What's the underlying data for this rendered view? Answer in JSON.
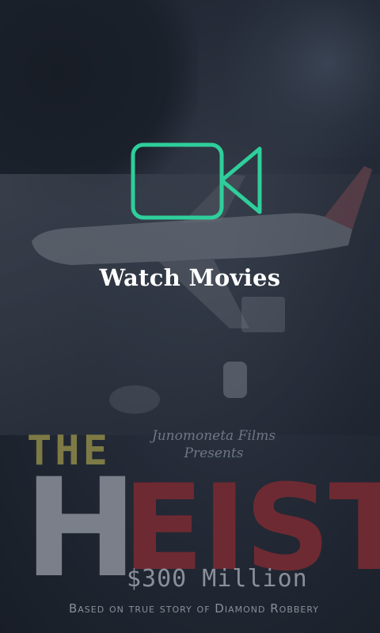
{
  "splash": {
    "icon": "video-camera-icon",
    "icon_color": "#2ecf9a",
    "title": "Watch Movies"
  },
  "poster": {
    "credit_line1": "Junomoneta Films",
    "credit_line2": "Presents",
    "title_the": "THE",
    "title_h": "H",
    "title_eist": "EIST",
    "amount": "$300 Million",
    "tagline": "Based on true story of Diamond Robbery"
  }
}
